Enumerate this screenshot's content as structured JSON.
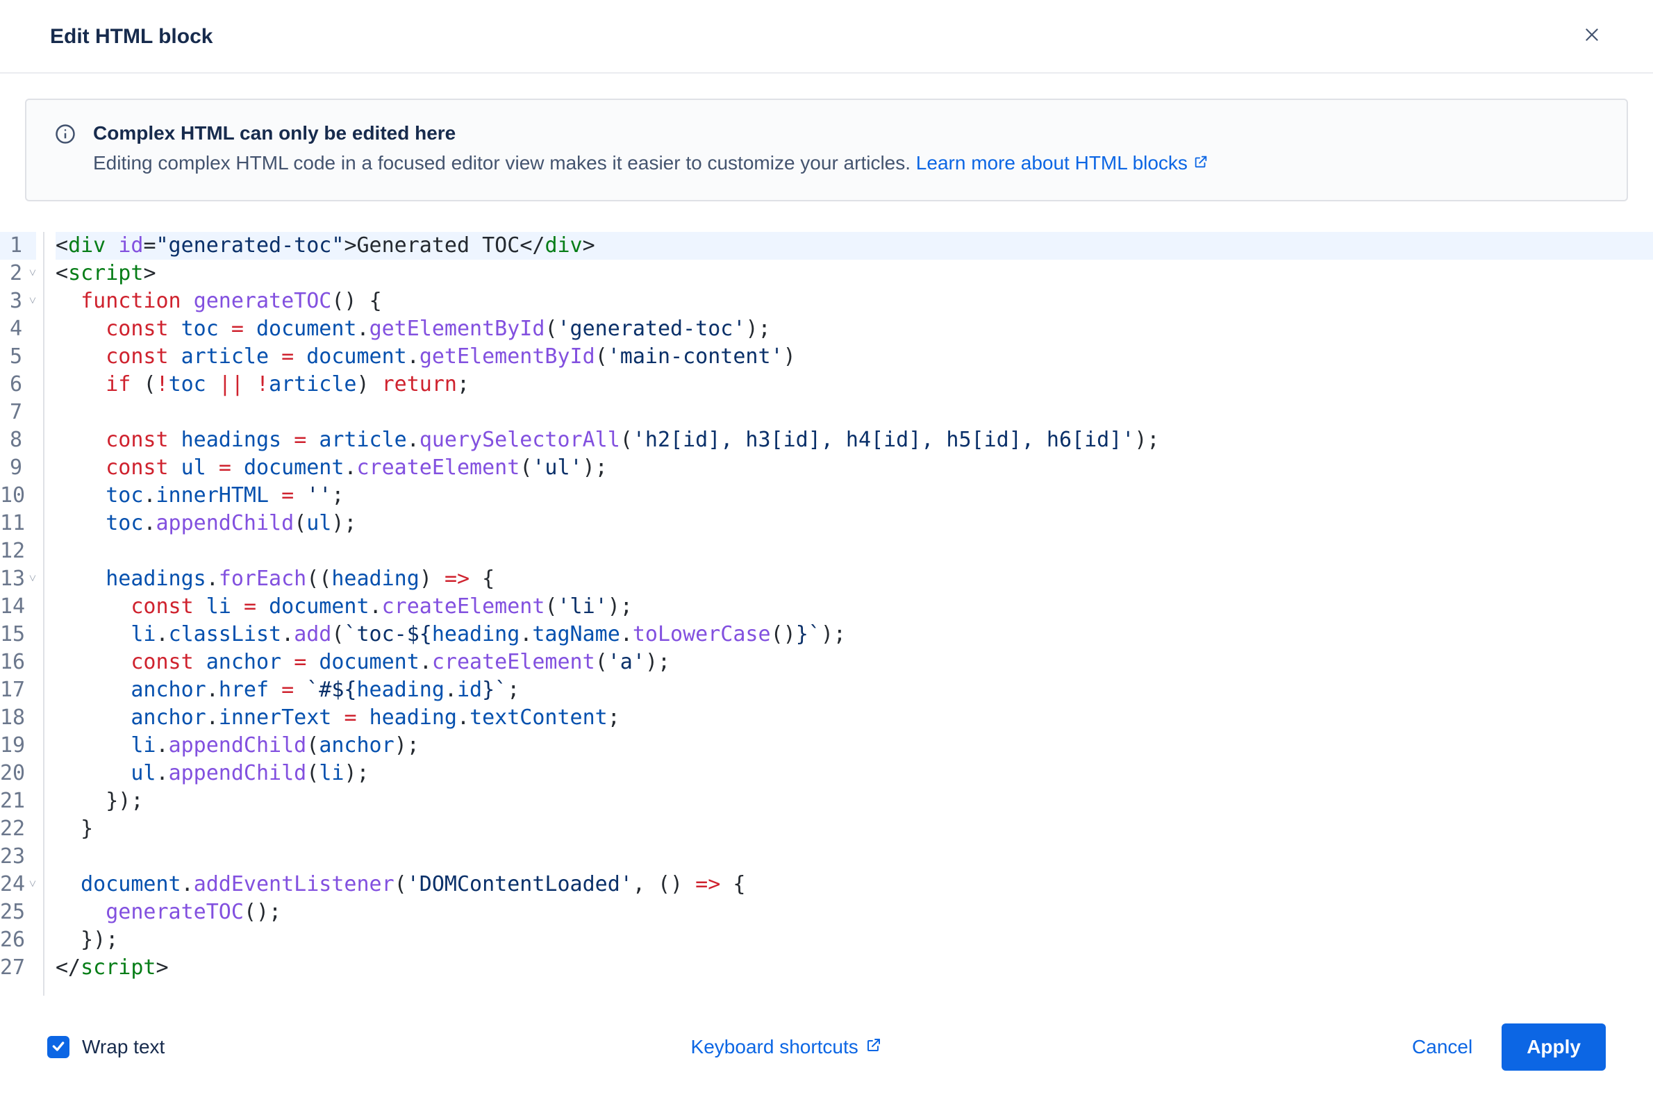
{
  "header": {
    "title": "Edit HTML block"
  },
  "banner": {
    "title": "Complex HTML can only be edited here",
    "desc": "Editing complex HTML code in a focused editor view makes it easier to customize your articles. ",
    "link_label": "Learn more about HTML blocks"
  },
  "editor": {
    "lines": [
      {
        "n": 1,
        "fold": "",
        "hl": true,
        "tokens": [
          {
            "c": "t-punc",
            "t": "<"
          },
          {
            "c": "t-tag",
            "t": "div"
          },
          {
            "c": "t-text",
            "t": " "
          },
          {
            "c": "t-attr",
            "t": "id"
          },
          {
            "c": "t-punc",
            "t": "="
          },
          {
            "c": "t-str",
            "t": "\"generated-toc\""
          },
          {
            "c": "t-punc",
            "t": ">"
          },
          {
            "c": "t-text",
            "t": "Generated TOC"
          },
          {
            "c": "t-punc",
            "t": "</"
          },
          {
            "c": "t-tag",
            "t": "div"
          },
          {
            "c": "t-punc",
            "t": ">"
          }
        ]
      },
      {
        "n": 2,
        "fold": "v",
        "tokens": [
          {
            "c": "t-punc",
            "t": "<"
          },
          {
            "c": "t-tag",
            "t": "script"
          },
          {
            "c": "t-punc",
            "t": ">"
          }
        ]
      },
      {
        "n": 3,
        "fold": "v",
        "tokens": [
          {
            "c": "t-text",
            "t": "  "
          },
          {
            "c": "t-kw",
            "t": "function"
          },
          {
            "c": "t-text",
            "t": " "
          },
          {
            "c": "t-fn",
            "t": "generateTOC"
          },
          {
            "c": "t-punc",
            "t": "()"
          },
          {
            "c": "t-text",
            "t": " "
          },
          {
            "c": "t-punc",
            "t": "{"
          }
        ]
      },
      {
        "n": 4,
        "fold": "",
        "tokens": [
          {
            "c": "t-text",
            "t": "    "
          },
          {
            "c": "t-kw",
            "t": "const"
          },
          {
            "c": "t-text",
            "t": " "
          },
          {
            "c": "t-var",
            "t": "toc"
          },
          {
            "c": "t-text",
            "t": " "
          },
          {
            "c": "t-op",
            "t": "="
          },
          {
            "c": "t-text",
            "t": " "
          },
          {
            "c": "t-var",
            "t": "document"
          },
          {
            "c": "t-punc",
            "t": "."
          },
          {
            "c": "t-fn",
            "t": "getElementById"
          },
          {
            "c": "t-punc",
            "t": "("
          },
          {
            "c": "t-str",
            "t": "'generated-toc'"
          },
          {
            "c": "t-punc",
            "t": ");"
          }
        ]
      },
      {
        "n": 5,
        "fold": "",
        "tokens": [
          {
            "c": "t-text",
            "t": "    "
          },
          {
            "c": "t-kw",
            "t": "const"
          },
          {
            "c": "t-text",
            "t": " "
          },
          {
            "c": "t-var",
            "t": "article"
          },
          {
            "c": "t-text",
            "t": " "
          },
          {
            "c": "t-op",
            "t": "="
          },
          {
            "c": "t-text",
            "t": " "
          },
          {
            "c": "t-var",
            "t": "document"
          },
          {
            "c": "t-punc",
            "t": "."
          },
          {
            "c": "t-fn",
            "t": "getElementById"
          },
          {
            "c": "t-punc",
            "t": "("
          },
          {
            "c": "t-str",
            "t": "'main-content'"
          },
          {
            "c": "t-punc",
            "t": ")"
          }
        ]
      },
      {
        "n": 6,
        "fold": "",
        "tokens": [
          {
            "c": "t-text",
            "t": "    "
          },
          {
            "c": "t-kw",
            "t": "if"
          },
          {
            "c": "t-text",
            "t": " "
          },
          {
            "c": "t-punc",
            "t": "("
          },
          {
            "c": "t-op",
            "t": "!"
          },
          {
            "c": "t-var",
            "t": "toc"
          },
          {
            "c": "t-text",
            "t": " "
          },
          {
            "c": "t-op",
            "t": "||"
          },
          {
            "c": "t-text",
            "t": " "
          },
          {
            "c": "t-op",
            "t": "!"
          },
          {
            "c": "t-var",
            "t": "article"
          },
          {
            "c": "t-punc",
            "t": ")"
          },
          {
            "c": "t-text",
            "t": " "
          },
          {
            "c": "t-kw",
            "t": "return"
          },
          {
            "c": "t-punc",
            "t": ";"
          }
        ]
      },
      {
        "n": 7,
        "fold": "",
        "tokens": [
          {
            "c": "t-text",
            "t": ""
          }
        ]
      },
      {
        "n": 8,
        "fold": "",
        "tokens": [
          {
            "c": "t-text",
            "t": "    "
          },
          {
            "c": "t-kw",
            "t": "const"
          },
          {
            "c": "t-text",
            "t": " "
          },
          {
            "c": "t-var",
            "t": "headings"
          },
          {
            "c": "t-text",
            "t": " "
          },
          {
            "c": "t-op",
            "t": "="
          },
          {
            "c": "t-text",
            "t": " "
          },
          {
            "c": "t-var",
            "t": "article"
          },
          {
            "c": "t-punc",
            "t": "."
          },
          {
            "c": "t-fn",
            "t": "querySelectorAll"
          },
          {
            "c": "t-punc",
            "t": "("
          },
          {
            "c": "t-str",
            "t": "'h2[id], h3[id], h4[id], h5[id], h6[id]'"
          },
          {
            "c": "t-punc",
            "t": ");"
          }
        ]
      },
      {
        "n": 9,
        "fold": "",
        "tokens": [
          {
            "c": "t-text",
            "t": "    "
          },
          {
            "c": "t-kw",
            "t": "const"
          },
          {
            "c": "t-text",
            "t": " "
          },
          {
            "c": "t-var",
            "t": "ul"
          },
          {
            "c": "t-text",
            "t": " "
          },
          {
            "c": "t-op",
            "t": "="
          },
          {
            "c": "t-text",
            "t": " "
          },
          {
            "c": "t-var",
            "t": "document"
          },
          {
            "c": "t-punc",
            "t": "."
          },
          {
            "c": "t-fn",
            "t": "createElement"
          },
          {
            "c": "t-punc",
            "t": "("
          },
          {
            "c": "t-str",
            "t": "'ul'"
          },
          {
            "c": "t-punc",
            "t": ");"
          }
        ]
      },
      {
        "n": 10,
        "fold": "",
        "tokens": [
          {
            "c": "t-text",
            "t": "    "
          },
          {
            "c": "t-var",
            "t": "toc"
          },
          {
            "c": "t-punc",
            "t": "."
          },
          {
            "c": "t-var",
            "t": "innerHTML"
          },
          {
            "c": "t-text",
            "t": " "
          },
          {
            "c": "t-op",
            "t": "="
          },
          {
            "c": "t-text",
            "t": " "
          },
          {
            "c": "t-str",
            "t": "''"
          },
          {
            "c": "t-punc",
            "t": ";"
          }
        ]
      },
      {
        "n": 11,
        "fold": "",
        "tokens": [
          {
            "c": "t-text",
            "t": "    "
          },
          {
            "c": "t-var",
            "t": "toc"
          },
          {
            "c": "t-punc",
            "t": "."
          },
          {
            "c": "t-fn",
            "t": "appendChild"
          },
          {
            "c": "t-punc",
            "t": "("
          },
          {
            "c": "t-var",
            "t": "ul"
          },
          {
            "c": "t-punc",
            "t": ");"
          }
        ]
      },
      {
        "n": 12,
        "fold": "",
        "tokens": [
          {
            "c": "t-text",
            "t": ""
          }
        ]
      },
      {
        "n": 13,
        "fold": "v",
        "tokens": [
          {
            "c": "t-text",
            "t": "    "
          },
          {
            "c": "t-var",
            "t": "headings"
          },
          {
            "c": "t-punc",
            "t": "."
          },
          {
            "c": "t-fn",
            "t": "forEach"
          },
          {
            "c": "t-punc",
            "t": "(("
          },
          {
            "c": "t-var",
            "t": "heading"
          },
          {
            "c": "t-punc",
            "t": ")"
          },
          {
            "c": "t-text",
            "t": " "
          },
          {
            "c": "t-op",
            "t": "=>"
          },
          {
            "c": "t-text",
            "t": " "
          },
          {
            "c": "t-punc",
            "t": "{"
          }
        ]
      },
      {
        "n": 14,
        "fold": "",
        "tokens": [
          {
            "c": "t-text",
            "t": "      "
          },
          {
            "c": "t-kw",
            "t": "const"
          },
          {
            "c": "t-text",
            "t": " "
          },
          {
            "c": "t-var",
            "t": "li"
          },
          {
            "c": "t-text",
            "t": " "
          },
          {
            "c": "t-op",
            "t": "="
          },
          {
            "c": "t-text",
            "t": " "
          },
          {
            "c": "t-var",
            "t": "document"
          },
          {
            "c": "t-punc",
            "t": "."
          },
          {
            "c": "t-fn",
            "t": "createElement"
          },
          {
            "c": "t-punc",
            "t": "("
          },
          {
            "c": "t-str",
            "t": "'li'"
          },
          {
            "c": "t-punc",
            "t": ");"
          }
        ]
      },
      {
        "n": 15,
        "fold": "",
        "tokens": [
          {
            "c": "t-text",
            "t": "      "
          },
          {
            "c": "t-var",
            "t": "li"
          },
          {
            "c": "t-punc",
            "t": "."
          },
          {
            "c": "t-var",
            "t": "classList"
          },
          {
            "c": "t-punc",
            "t": "."
          },
          {
            "c": "t-fn",
            "t": "add"
          },
          {
            "c": "t-punc",
            "t": "("
          },
          {
            "c": "t-str",
            "t": "`toc-${"
          },
          {
            "c": "t-var",
            "t": "heading"
          },
          {
            "c": "t-punc",
            "t": "."
          },
          {
            "c": "t-var",
            "t": "tagName"
          },
          {
            "c": "t-punc",
            "t": "."
          },
          {
            "c": "t-fn",
            "t": "toLowerCase"
          },
          {
            "c": "t-punc",
            "t": "()"
          },
          {
            "c": "t-str",
            "t": "}`"
          },
          {
            "c": "t-punc",
            "t": ");"
          }
        ]
      },
      {
        "n": 16,
        "fold": "",
        "tokens": [
          {
            "c": "t-text",
            "t": "      "
          },
          {
            "c": "t-kw",
            "t": "const"
          },
          {
            "c": "t-text",
            "t": " "
          },
          {
            "c": "t-var",
            "t": "anchor"
          },
          {
            "c": "t-text",
            "t": " "
          },
          {
            "c": "t-op",
            "t": "="
          },
          {
            "c": "t-text",
            "t": " "
          },
          {
            "c": "t-var",
            "t": "document"
          },
          {
            "c": "t-punc",
            "t": "."
          },
          {
            "c": "t-fn",
            "t": "createElement"
          },
          {
            "c": "t-punc",
            "t": "("
          },
          {
            "c": "t-str",
            "t": "'a'"
          },
          {
            "c": "t-punc",
            "t": ");"
          }
        ]
      },
      {
        "n": 17,
        "fold": "",
        "tokens": [
          {
            "c": "t-text",
            "t": "      "
          },
          {
            "c": "t-var",
            "t": "anchor"
          },
          {
            "c": "t-punc",
            "t": "."
          },
          {
            "c": "t-var",
            "t": "href"
          },
          {
            "c": "t-text",
            "t": " "
          },
          {
            "c": "t-op",
            "t": "="
          },
          {
            "c": "t-text",
            "t": " "
          },
          {
            "c": "t-str",
            "t": "`#${"
          },
          {
            "c": "t-var",
            "t": "heading"
          },
          {
            "c": "t-punc",
            "t": "."
          },
          {
            "c": "t-var",
            "t": "id"
          },
          {
            "c": "t-str",
            "t": "}`"
          },
          {
            "c": "t-punc",
            "t": ";"
          }
        ]
      },
      {
        "n": 18,
        "fold": "",
        "tokens": [
          {
            "c": "t-text",
            "t": "      "
          },
          {
            "c": "t-var",
            "t": "anchor"
          },
          {
            "c": "t-punc",
            "t": "."
          },
          {
            "c": "t-var",
            "t": "innerText"
          },
          {
            "c": "t-text",
            "t": " "
          },
          {
            "c": "t-op",
            "t": "="
          },
          {
            "c": "t-text",
            "t": " "
          },
          {
            "c": "t-var",
            "t": "heading"
          },
          {
            "c": "t-punc",
            "t": "."
          },
          {
            "c": "t-var",
            "t": "textContent"
          },
          {
            "c": "t-punc",
            "t": ";"
          }
        ]
      },
      {
        "n": 19,
        "fold": "",
        "tokens": [
          {
            "c": "t-text",
            "t": "      "
          },
          {
            "c": "t-var",
            "t": "li"
          },
          {
            "c": "t-punc",
            "t": "."
          },
          {
            "c": "t-fn",
            "t": "appendChild"
          },
          {
            "c": "t-punc",
            "t": "("
          },
          {
            "c": "t-var",
            "t": "anchor"
          },
          {
            "c": "t-punc",
            "t": ");"
          }
        ]
      },
      {
        "n": 20,
        "fold": "",
        "tokens": [
          {
            "c": "t-text",
            "t": "      "
          },
          {
            "c": "t-var",
            "t": "ul"
          },
          {
            "c": "t-punc",
            "t": "."
          },
          {
            "c": "t-fn",
            "t": "appendChild"
          },
          {
            "c": "t-punc",
            "t": "("
          },
          {
            "c": "t-var",
            "t": "li"
          },
          {
            "c": "t-punc",
            "t": ");"
          }
        ]
      },
      {
        "n": 21,
        "fold": "",
        "tokens": [
          {
            "c": "t-text",
            "t": "    "
          },
          {
            "c": "t-punc",
            "t": "});"
          }
        ]
      },
      {
        "n": 22,
        "fold": "",
        "tokens": [
          {
            "c": "t-text",
            "t": "  "
          },
          {
            "c": "t-punc",
            "t": "}"
          }
        ]
      },
      {
        "n": 23,
        "fold": "",
        "tokens": [
          {
            "c": "t-text",
            "t": ""
          }
        ]
      },
      {
        "n": 24,
        "fold": "v",
        "tokens": [
          {
            "c": "t-text",
            "t": "  "
          },
          {
            "c": "t-var",
            "t": "document"
          },
          {
            "c": "t-punc",
            "t": "."
          },
          {
            "c": "t-fn",
            "t": "addEventListener"
          },
          {
            "c": "t-punc",
            "t": "("
          },
          {
            "c": "t-str",
            "t": "'DOMContentLoaded'"
          },
          {
            "c": "t-punc",
            "t": ","
          },
          {
            "c": "t-text",
            "t": " "
          },
          {
            "c": "t-punc",
            "t": "()"
          },
          {
            "c": "t-text",
            "t": " "
          },
          {
            "c": "t-op",
            "t": "=>"
          },
          {
            "c": "t-text",
            "t": " "
          },
          {
            "c": "t-punc",
            "t": "{"
          }
        ]
      },
      {
        "n": 25,
        "fold": "",
        "tokens": [
          {
            "c": "t-text",
            "t": "    "
          },
          {
            "c": "t-fn",
            "t": "generateTOC"
          },
          {
            "c": "t-punc",
            "t": "();"
          }
        ]
      },
      {
        "n": 26,
        "fold": "",
        "tokens": [
          {
            "c": "t-text",
            "t": "  "
          },
          {
            "c": "t-punc",
            "t": "});"
          }
        ]
      },
      {
        "n": 27,
        "fold": "",
        "tokens": [
          {
            "c": "t-punc",
            "t": "</"
          },
          {
            "c": "t-tag",
            "t": "script"
          },
          {
            "c": "t-punc",
            "t": ">"
          }
        ]
      }
    ]
  },
  "footer": {
    "wrap_label": "Wrap text",
    "keyboard_label": "Keyboard shortcuts",
    "cancel_label": "Cancel",
    "apply_label": "Apply"
  }
}
